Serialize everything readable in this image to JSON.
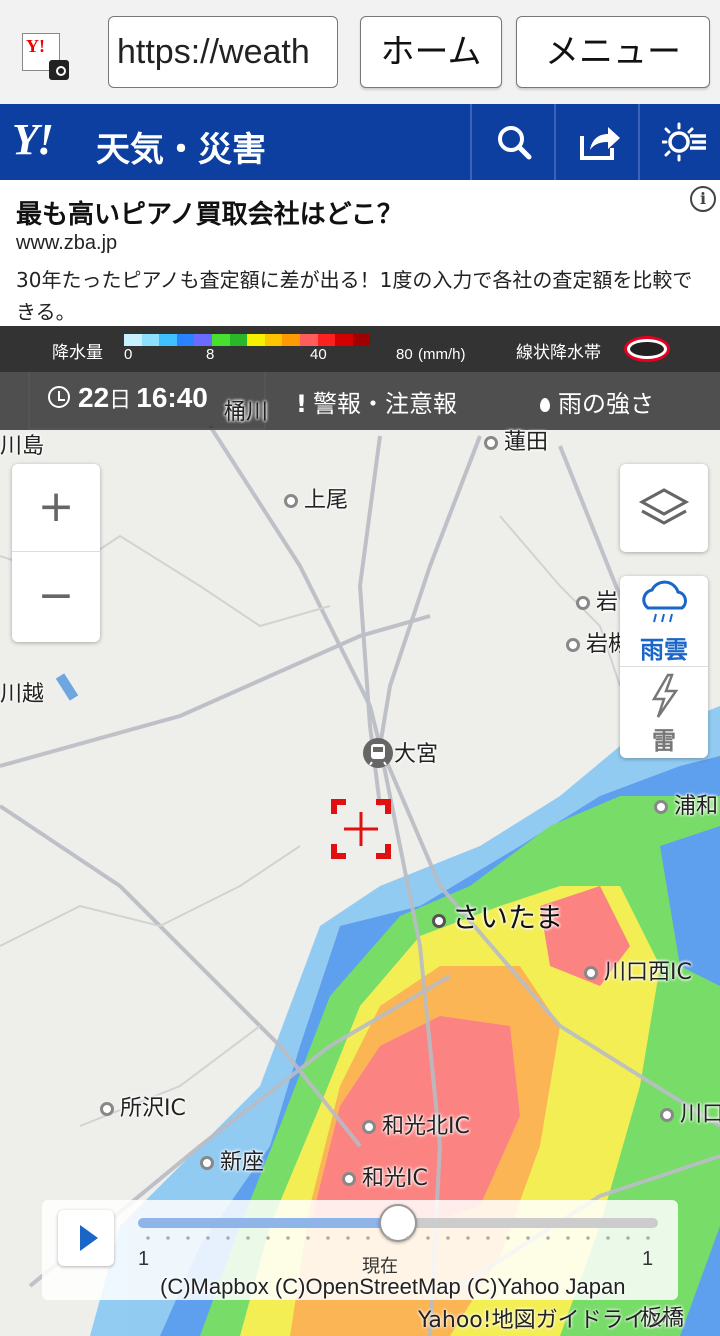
{
  "browser": {
    "url": "https://weath",
    "home_label": "ホーム",
    "menu_label": "メニュー",
    "favicon_text": "Y!"
  },
  "header": {
    "logo": "Y!",
    "title": "天気・災害",
    "icons": [
      "search-icon",
      "share-icon",
      "display-settings-icon"
    ]
  },
  "ad": {
    "title": "最も高いピアノ買取会社はどこ？",
    "url": "www.zba.jp",
    "description": "30年たったピアノも査定額に差が出る！1度の入力で各社の査定額を比較できる。",
    "info_icon": "i"
  },
  "legend": {
    "label": "降水量",
    "ticks": [
      "0",
      "8",
      "40",
      "80"
    ],
    "unit": "(mm/h)",
    "colors": [
      "#c8f0ff",
      "#8ee0ff",
      "#40c0ff",
      "#2a82ff",
      "#6b6bff",
      "#47e030",
      "#2ab82a",
      "#f4f000",
      "#ffc400",
      "#ff9a00",
      "#ff5c5c",
      "#ff2020",
      "#d40000",
      "#a00000"
    ],
    "senjo_label": "線状降水帯"
  },
  "controls": {
    "day": "22",
    "day_unit": "日",
    "time": "16:40",
    "warning_label": "警報・注意報",
    "rain_label": "雨の強さ"
  },
  "map": {
    "places": [
      {
        "name": "川島",
        "dot": false
      },
      {
        "name": "桶川",
        "dot": false
      },
      {
        "name": "蓮田",
        "dot": true
      },
      {
        "name": "上尾",
        "dot": true
      },
      {
        "name": "岩",
        "dot": true
      },
      {
        "name": "岩槻",
        "dot": true
      },
      {
        "name": "川越",
        "dot": false
      },
      {
        "name": "大宮",
        "dot": false
      },
      {
        "name": "浦和",
        "dot": true
      },
      {
        "name": "さいたま",
        "dot": true
      },
      {
        "name": "川口西IC",
        "dot": true
      },
      {
        "name": "所沢IC",
        "dot": true
      },
      {
        "name": "和光北IC",
        "dot": true
      },
      {
        "name": "川口",
        "dot": true
      },
      {
        "name": "新座",
        "dot": true
      },
      {
        "name": "和光IC",
        "dot": true
      },
      {
        "name": "板橋",
        "dot": false
      }
    ],
    "zoom_in": "+",
    "zoom_out": "−",
    "layer_types": [
      "雨雲",
      "雷"
    ]
  },
  "player": {
    "left_label": "1",
    "mid_label": "現在",
    "right_label": "1",
    "progress": 0.5
  },
  "attribution": "(C)Mapbox (C)OpenStreetMap (C)Yahoo Japan",
  "guide": "Yahoo!地図ガイドライン"
}
